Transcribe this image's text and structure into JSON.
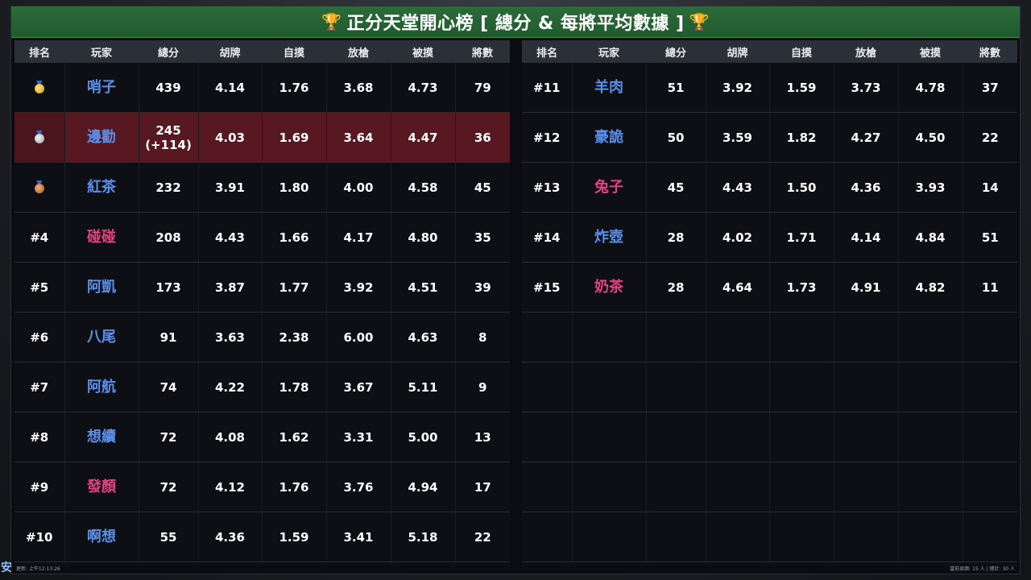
{
  "title": {
    "text": "正分天堂開心榜 [ 總分 & 每將平均數據 ]"
  },
  "headers": [
    "排名",
    "玩家",
    "總分",
    "胡牌",
    "自摸",
    "放槍",
    "被摸",
    "將數"
  ],
  "left_rows": [
    {
      "rank": "",
      "medal": "gold",
      "name": "哨子",
      "color": "blue",
      "total": "439",
      "bonus": "",
      "hu": "4.14",
      "zimo": "1.76",
      "fangqiang": "3.68",
      "beimo": "4.73",
      "games": "79"
    },
    {
      "rank": "",
      "medal": "silver",
      "name": "邊勸",
      "color": "blue",
      "total": "245",
      "bonus": "(+114)",
      "hu": "4.03",
      "zimo": "1.69",
      "fangqiang": "3.64",
      "beimo": "4.47",
      "games": "36",
      "highlight": true
    },
    {
      "rank": "",
      "medal": "bronze",
      "name": "紅茶",
      "color": "blue",
      "total": "232",
      "bonus": "",
      "hu": "3.91",
      "zimo": "1.80",
      "fangqiang": "4.00",
      "beimo": "4.58",
      "games": "45"
    },
    {
      "rank": "#4",
      "medal": "",
      "name": "碰碰",
      "color": "pink",
      "total": "208",
      "bonus": "",
      "hu": "4.43",
      "zimo": "1.66",
      "fangqiang": "4.17",
      "beimo": "4.80",
      "games": "35"
    },
    {
      "rank": "#5",
      "medal": "",
      "name": "阿凱",
      "color": "blue",
      "total": "173",
      "bonus": "",
      "hu": "3.87",
      "zimo": "1.77",
      "fangqiang": "3.92",
      "beimo": "4.51",
      "games": "39"
    },
    {
      "rank": "#6",
      "medal": "",
      "name": "八尾",
      "color": "blue",
      "total": "91",
      "bonus": "",
      "hu": "3.63",
      "zimo": "2.38",
      "fangqiang": "6.00",
      "beimo": "4.63",
      "games": "8"
    },
    {
      "rank": "#7",
      "medal": "",
      "name": "阿航",
      "color": "blue",
      "total": "74",
      "bonus": "",
      "hu": "4.22",
      "zimo": "1.78",
      "fangqiang": "3.67",
      "beimo": "5.11",
      "games": "9"
    },
    {
      "rank": "#8",
      "medal": "",
      "name": "想續",
      "color": "blue",
      "total": "72",
      "bonus": "",
      "hu": "4.08",
      "zimo": "1.62",
      "fangqiang": "3.31",
      "beimo": "5.00",
      "games": "13"
    },
    {
      "rank": "#9",
      "medal": "",
      "name": "發顏",
      "color": "pink",
      "total": "72",
      "bonus": "",
      "hu": "4.12",
      "zimo": "1.76",
      "fangqiang": "3.76",
      "beimo": "4.94",
      "games": "17"
    },
    {
      "rank": "#10",
      "medal": "",
      "name": "啊想",
      "color": "blue",
      "total": "55",
      "bonus": "",
      "hu": "4.36",
      "zimo": "1.59",
      "fangqiang": "3.41",
      "beimo": "5.18",
      "games": "22"
    }
  ],
  "right_rows": [
    {
      "rank": "#11",
      "name": "羊肉",
      "color": "blue",
      "total": "51",
      "hu": "3.92",
      "zimo": "1.59",
      "fangqiang": "3.73",
      "beimo": "4.78",
      "games": "37"
    },
    {
      "rank": "#12",
      "name": "豪詭",
      "color": "blue",
      "total": "50",
      "hu": "3.59",
      "zimo": "1.82",
      "fangqiang": "4.27",
      "beimo": "4.50",
      "games": "22"
    },
    {
      "rank": "#13",
      "name": "兔子",
      "color": "pink",
      "total": "45",
      "hu": "4.43",
      "zimo": "1.50",
      "fangqiang": "4.36",
      "beimo": "3.93",
      "games": "14"
    },
    {
      "rank": "#14",
      "name": "炸壺",
      "color": "blue",
      "total": "28",
      "hu": "4.02",
      "zimo": "1.71",
      "fangqiang": "4.14",
      "beimo": "4.84",
      "games": "51"
    },
    {
      "rank": "#15",
      "name": "奶茶",
      "color": "pink",
      "total": "28",
      "hu": "4.64",
      "zimo": "1.73",
      "fangqiang": "4.91",
      "beimo": "4.82",
      "games": "11"
    }
  ],
  "footer": {
    "updated": "更新: 上午12:13:26",
    "summary": "當前頁面: 15 人 | 總計: 30 人",
    "corner": "安"
  },
  "colors": {
    "title_bg": "#1f5a2d",
    "name_blue": "#5b8fe8",
    "name_pink": "#e0457f",
    "highlight_row": "#571821"
  }
}
